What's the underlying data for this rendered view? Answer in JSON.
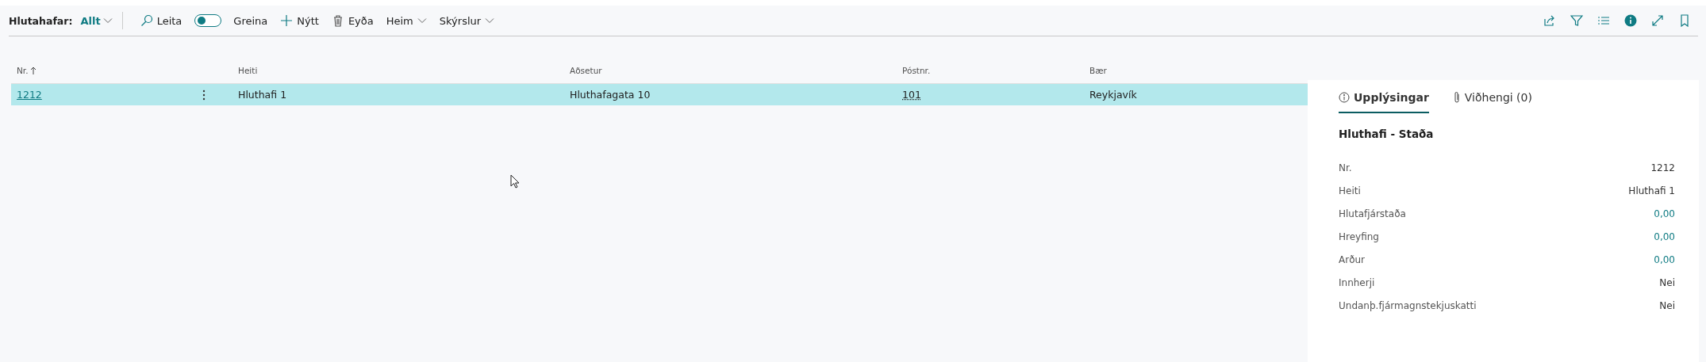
{
  "toolbar": {
    "title": "Hlutahafar:",
    "filter": "Allt",
    "actions": [
      {
        "kind": "search",
        "label": "Leita"
      },
      {
        "kind": "toggle",
        "label": "Greina",
        "on": false
      },
      {
        "kind": "new",
        "label": "Nýtt"
      },
      {
        "kind": "delete",
        "label": "Eyða"
      },
      {
        "kind": "menu",
        "label": "Heim"
      },
      {
        "kind": "menu",
        "label": "Skýrslur"
      }
    ]
  },
  "table": {
    "columns": [
      {
        "label": "Nr.",
        "sorted": true
      },
      {
        "label": "Heiti",
        "sorted": false
      },
      {
        "label": "Aðsetur",
        "sorted": false
      },
      {
        "label": "Póstnr.",
        "sorted": false
      },
      {
        "label": "Bær",
        "sorted": false
      }
    ],
    "rows": [
      {
        "selected": true,
        "cells": [
          "1212",
          "Hluthafi 1",
          "Hluthafagata 10",
          "101",
          "Reykjavík"
        ]
      }
    ]
  },
  "factbox": {
    "tabs": [
      {
        "label": "Upplýsingar",
        "selected": true
      },
      {
        "label": "Viðhengi (0)",
        "selected": false
      }
    ],
    "title": "Hluthafi - Staða",
    "fields": [
      {
        "label": "Nr.",
        "value": "1212",
        "link": false
      },
      {
        "label": "Heiti",
        "value": "Hluthafi 1",
        "link": false
      },
      {
        "label": "Hlutafjárstaða",
        "value": "0,00",
        "link": true
      },
      {
        "label": "Hreyfing",
        "value": "0,00",
        "link": true
      },
      {
        "label": "Arður",
        "value": "0,00",
        "link": true
      },
      {
        "label": "Innherji",
        "value": "Nei",
        "link": false
      },
      {
        "label": "Undanþ.fjármagnstekjuskatti",
        "value": "Nei",
        "link": false
      }
    ]
  }
}
